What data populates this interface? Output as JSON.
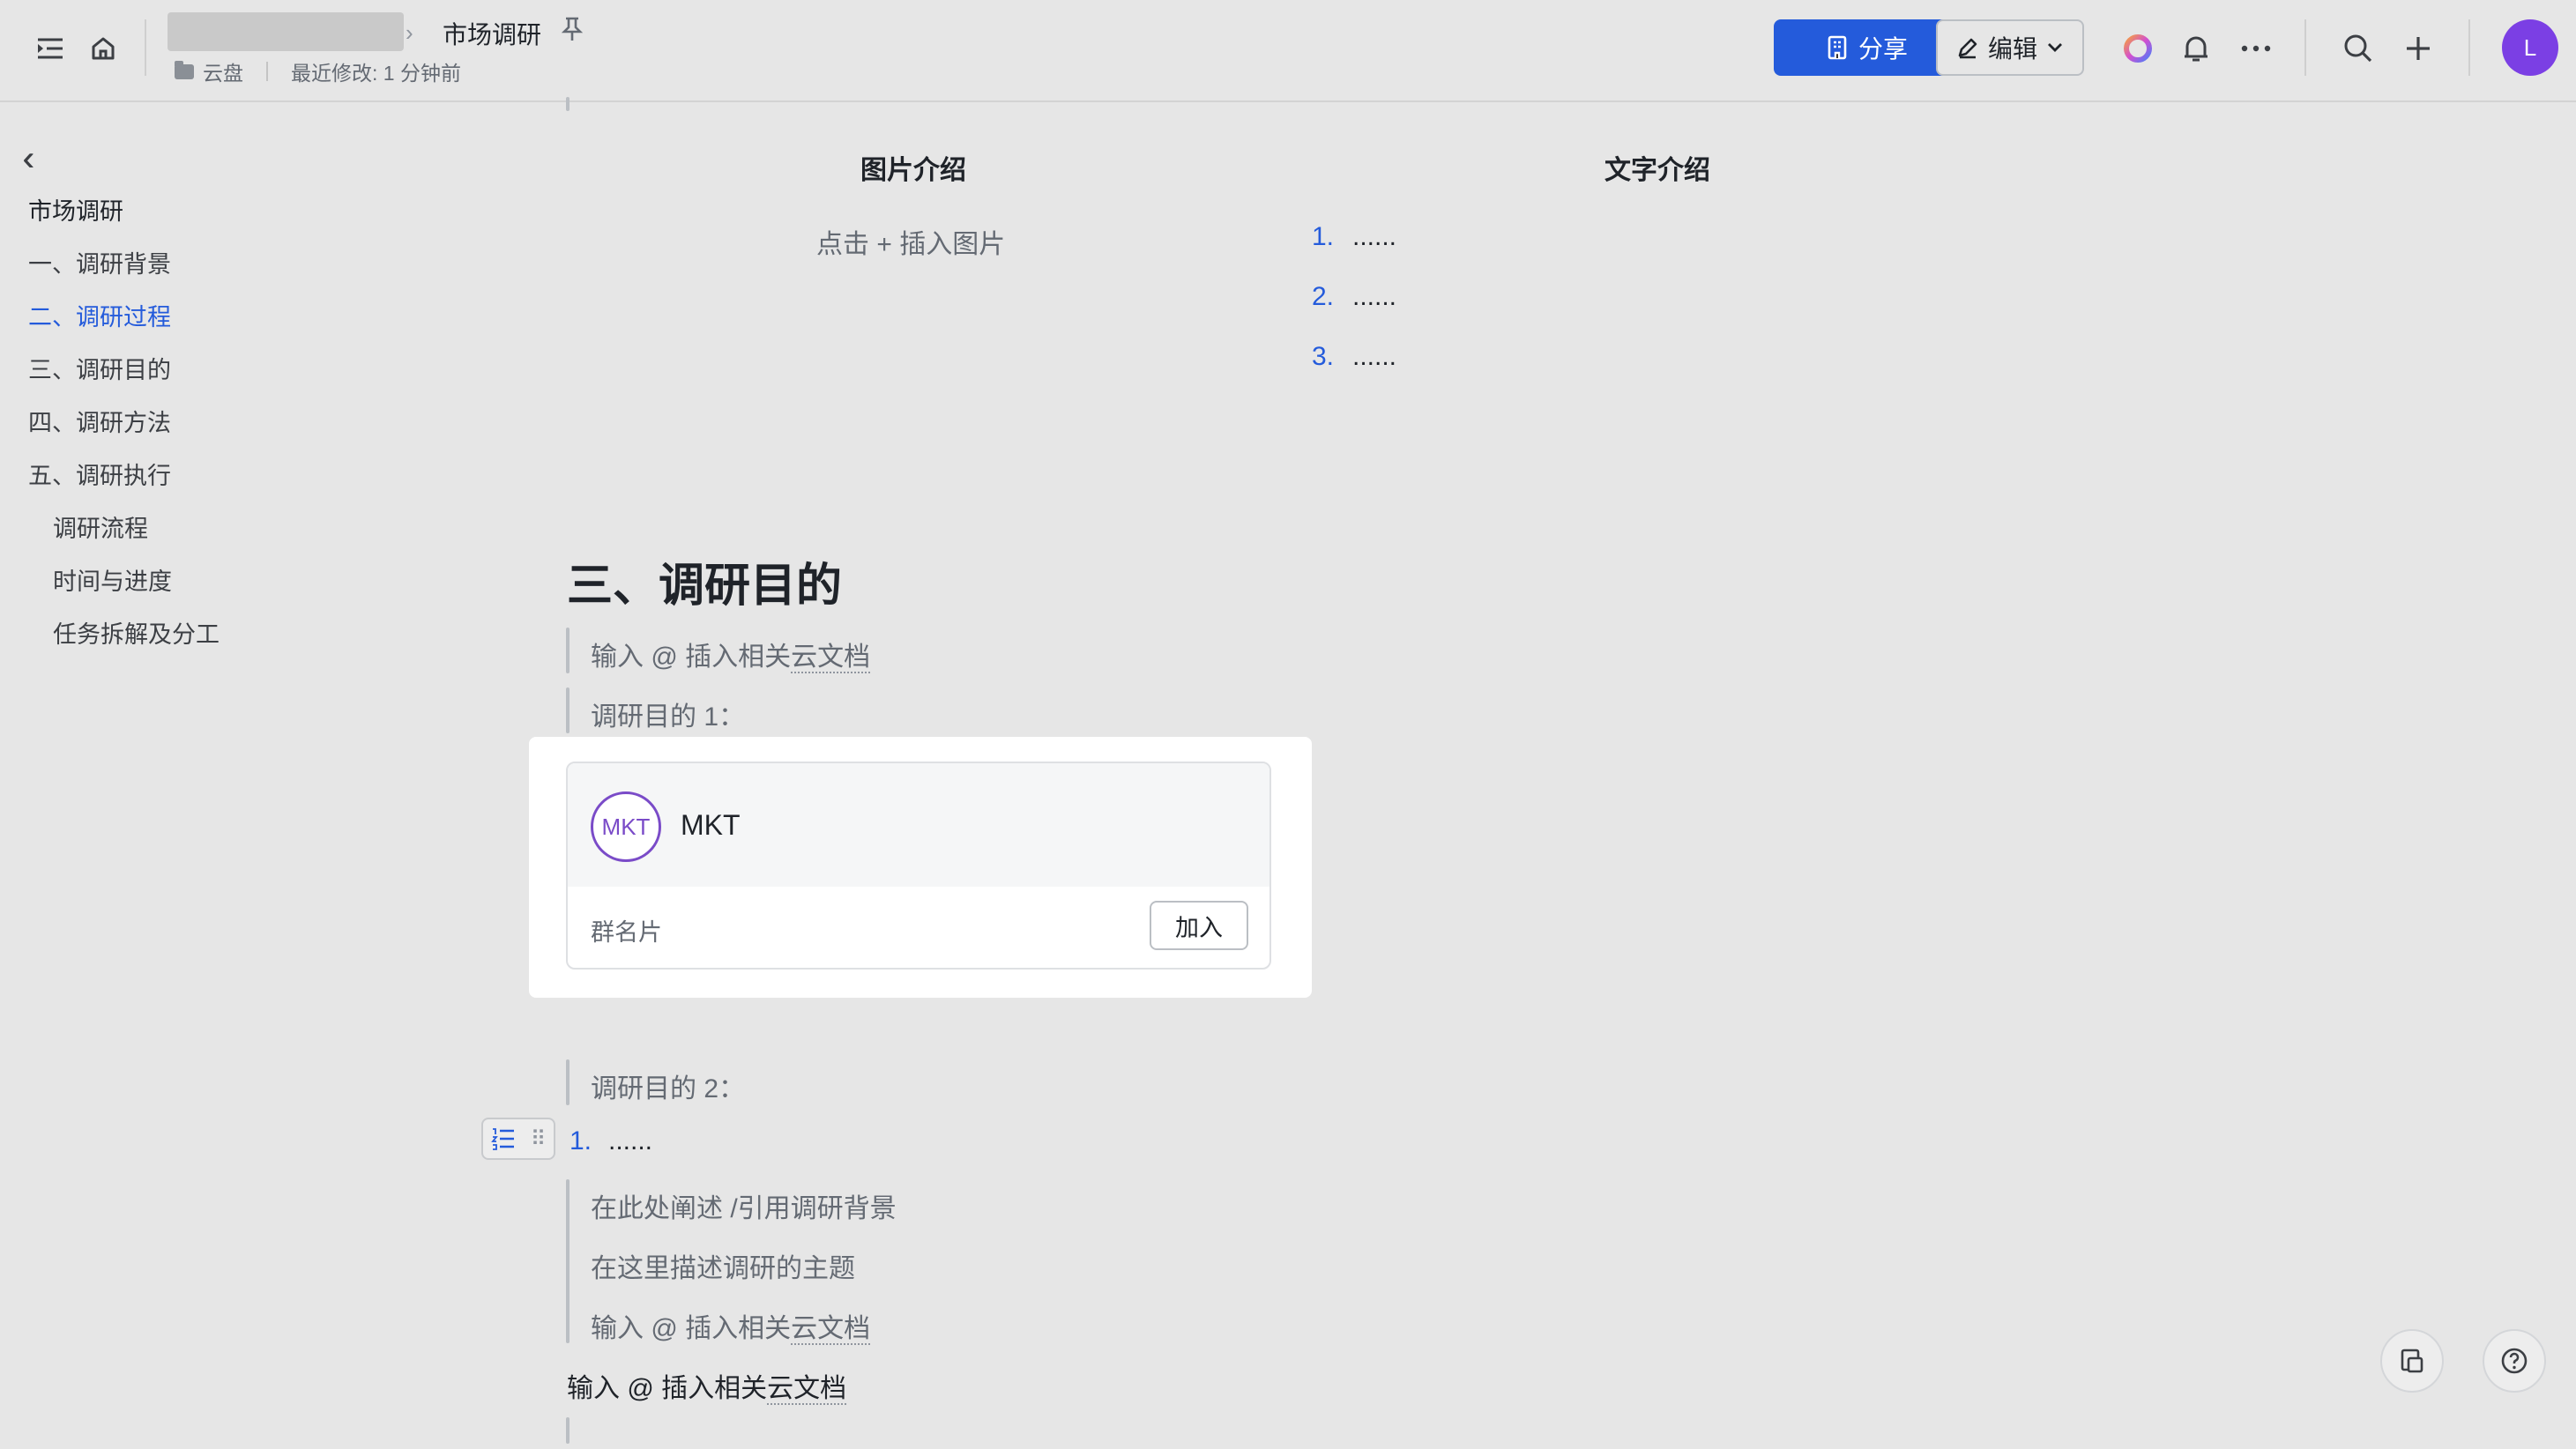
{
  "header": {
    "doc_title": "市场调研",
    "location": "云盘",
    "last_modified": "最近修改: 1 分钟前",
    "share_label": "分享",
    "edit_label": "编辑",
    "avatar_initial": "L"
  },
  "sidebar": {
    "title": "市场调研",
    "items": [
      {
        "label": "一、调研背景"
      },
      {
        "label": "二、调研过程"
      },
      {
        "label": "三、调研目的"
      },
      {
        "label": "四、调研方法"
      },
      {
        "label": "五、调研执行"
      },
      {
        "label": "调研流程"
      },
      {
        "label": "时间与进度"
      },
      {
        "label": "任务拆解及分工"
      }
    ]
  },
  "content": {
    "col1_heading": "图片介绍",
    "col1_placeholder": "点击 + 插入图片",
    "col2_heading": "文字介绍",
    "col2_list": [
      {
        "num": "1.",
        "text": "......"
      },
      {
        "num": "2.",
        "text": "......"
      },
      {
        "num": "3.",
        "text": "......"
      }
    ],
    "section_heading": "三、调研目的",
    "quote1_prefix": "输入 @ 插入相关",
    "quote1_link": "云文档",
    "purpose1": "调研目的 1：",
    "card": {
      "logo_text": "MKT",
      "name": "MKT",
      "label": "群名片",
      "join_label": "加入"
    },
    "purpose2": "调研目的 2：",
    "list_item": {
      "num": "1.",
      "text": "......"
    },
    "quote_lines": [
      "在此处阐述 /引用调研背景",
      "在这里描述调研的主题"
    ],
    "quote2_prefix": "输入 @ 插入相关",
    "quote2_link": "云文档",
    "body_prefix": "输入 @ 插入相关",
    "body_link": "云文档"
  }
}
